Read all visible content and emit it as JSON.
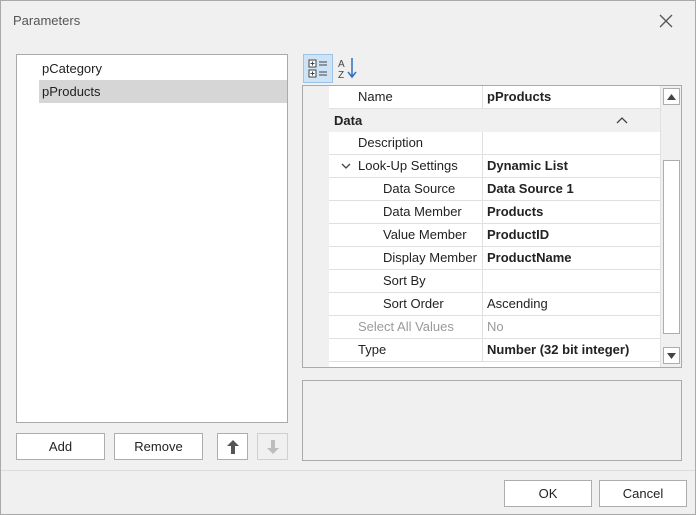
{
  "window": {
    "title": "Parameters"
  },
  "params": [
    {
      "label": "pCategory",
      "selected": false
    },
    {
      "label": "pProducts",
      "selected": true
    }
  ],
  "left_buttons": {
    "add": "Add",
    "remove": "Remove"
  },
  "toolbar": {
    "categorized_icon": "categorized-view-icon",
    "alphabetical_icon": "sort-az-icon"
  },
  "grid": {
    "top_row": {
      "name": "Name",
      "value": "pProducts"
    },
    "category": "Data",
    "rows": [
      {
        "name": "Description",
        "value": ""
      },
      {
        "name": "Look-Up Settings",
        "value": "Dynamic List"
      },
      {
        "name": "Data Source",
        "value": "Data Source 1"
      },
      {
        "name": "Data Member",
        "value": "Products"
      },
      {
        "name": "Value Member",
        "value": "ProductID"
      },
      {
        "name": "Display Member",
        "value": "ProductName"
      },
      {
        "name": "Sort By",
        "value": ""
      },
      {
        "name": "Sort Order",
        "value": "Ascending"
      },
      {
        "name": "Select All Values",
        "value": "No"
      },
      {
        "name": "Type",
        "value": "Number (32 bit integer)"
      }
    ]
  },
  "footer": {
    "ok": "OK",
    "cancel": "Cancel"
  },
  "colors": {
    "selected_row": "#d6d6d6",
    "active_toolbar": "#cfe3f7",
    "accent_icon": "#2f6fbf"
  }
}
